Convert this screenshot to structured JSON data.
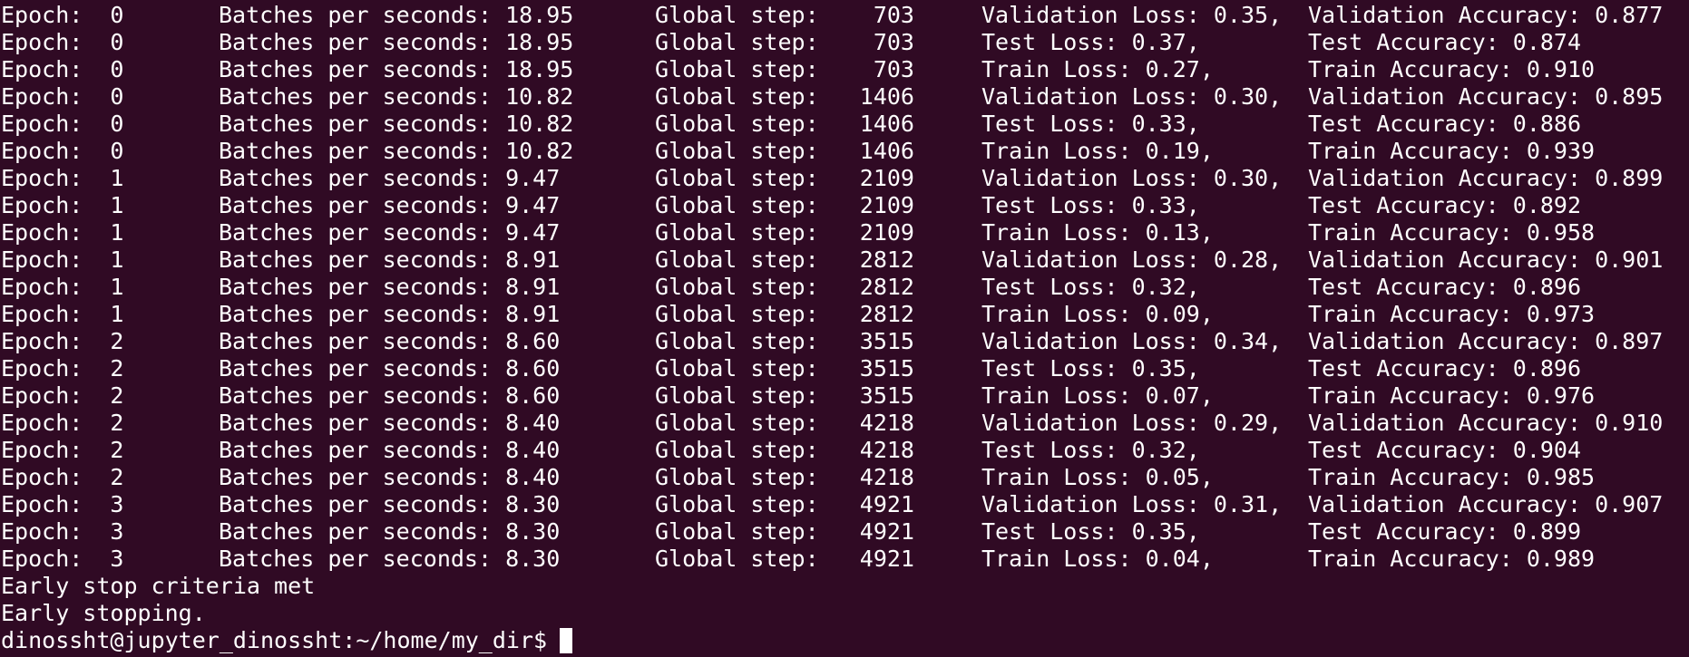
{
  "colors": {
    "background": "#300a24",
    "foreground": "#ffffff"
  },
  "log_rows": [
    {
      "epoch": "Epoch:  0",
      "bps": "Batches per seconds: 18.95",
      "step": "Global step:    703",
      "loss": "Validation Loss: 0.35,",
      "acc": "Validation Accuracy: 0.877"
    },
    {
      "epoch": "Epoch:  0",
      "bps": "Batches per seconds: 18.95",
      "step": "Global step:    703",
      "loss": "Test Loss: 0.37,",
      "acc": "Test Accuracy: 0.874"
    },
    {
      "epoch": "Epoch:  0",
      "bps": "Batches per seconds: 18.95",
      "step": "Global step:    703",
      "loss": "Train Loss: 0.27,",
      "acc": "Train Accuracy: 0.910"
    },
    {
      "epoch": "Epoch:  0",
      "bps": "Batches per seconds: 10.82",
      "step": "Global step:   1406",
      "loss": "Validation Loss: 0.30,",
      "acc": "Validation Accuracy: 0.895"
    },
    {
      "epoch": "Epoch:  0",
      "bps": "Batches per seconds: 10.82",
      "step": "Global step:   1406",
      "loss": "Test Loss: 0.33,",
      "acc": "Test Accuracy: 0.886"
    },
    {
      "epoch": "Epoch:  0",
      "bps": "Batches per seconds: 10.82",
      "step": "Global step:   1406",
      "loss": "Train Loss: 0.19,",
      "acc": "Train Accuracy: 0.939"
    },
    {
      "epoch": "Epoch:  1",
      "bps": "Batches per seconds: 9.47",
      "step": "Global step:   2109",
      "loss": "Validation Loss: 0.30,",
      "acc": "Validation Accuracy: 0.899"
    },
    {
      "epoch": "Epoch:  1",
      "bps": "Batches per seconds: 9.47",
      "step": "Global step:   2109",
      "loss": "Test Loss: 0.33,",
      "acc": "Test Accuracy: 0.892"
    },
    {
      "epoch": "Epoch:  1",
      "bps": "Batches per seconds: 9.47",
      "step": "Global step:   2109",
      "loss": "Train Loss: 0.13,",
      "acc": "Train Accuracy: 0.958"
    },
    {
      "epoch": "Epoch:  1",
      "bps": "Batches per seconds: 8.91",
      "step": "Global step:   2812",
      "loss": "Validation Loss: 0.28,",
      "acc": "Validation Accuracy: 0.901"
    },
    {
      "epoch": "Epoch:  1",
      "bps": "Batches per seconds: 8.91",
      "step": "Global step:   2812",
      "loss": "Test Loss: 0.32,",
      "acc": "Test Accuracy: 0.896"
    },
    {
      "epoch": "Epoch:  1",
      "bps": "Batches per seconds: 8.91",
      "step": "Global step:   2812",
      "loss": "Train Loss: 0.09,",
      "acc": "Train Accuracy: 0.973"
    },
    {
      "epoch": "Epoch:  2",
      "bps": "Batches per seconds: 8.60",
      "step": "Global step:   3515",
      "loss": "Validation Loss: 0.34,",
      "acc": "Validation Accuracy: 0.897"
    },
    {
      "epoch": "Epoch:  2",
      "bps": "Batches per seconds: 8.60",
      "step": "Global step:   3515",
      "loss": "Test Loss: 0.35,",
      "acc": "Test Accuracy: 0.896"
    },
    {
      "epoch": "Epoch:  2",
      "bps": "Batches per seconds: 8.60",
      "step": "Global step:   3515",
      "loss": "Train Loss: 0.07,",
      "acc": "Train Accuracy: 0.976"
    },
    {
      "epoch": "Epoch:  2",
      "bps": "Batches per seconds: 8.40",
      "step": "Global step:   4218",
      "loss": "Validation Loss: 0.29,",
      "acc": "Validation Accuracy: 0.910"
    },
    {
      "epoch": "Epoch:  2",
      "bps": "Batches per seconds: 8.40",
      "step": "Global step:   4218",
      "loss": "Test Loss: 0.32,",
      "acc": "Test Accuracy: 0.904"
    },
    {
      "epoch": "Epoch:  2",
      "bps": "Batches per seconds: 8.40",
      "step": "Global step:   4218",
      "loss": "Train Loss: 0.05,",
      "acc": "Train Accuracy: 0.985"
    },
    {
      "epoch": "Epoch:  3",
      "bps": "Batches per seconds: 8.30",
      "step": "Global step:   4921",
      "loss": "Validation Loss: 0.31,",
      "acc": "Validation Accuracy: 0.907"
    },
    {
      "epoch": "Epoch:  3",
      "bps": "Batches per seconds: 8.30",
      "step": "Global step:   4921",
      "loss": "Test Loss: 0.35,",
      "acc": "Test Accuracy: 0.899"
    },
    {
      "epoch": "Epoch:  3",
      "bps": "Batches per seconds: 8.30",
      "step": "Global step:   4921",
      "loss": "Train Loss: 0.04,",
      "acc": "Train Accuracy: 0.989"
    }
  ],
  "messages": {
    "early_stop_criteria": "Early stop criteria met",
    "early_stopping": "Early stopping."
  },
  "prompt": {
    "text": "dinossht@jupyter_dinossht:~/home/my_dir$"
  }
}
